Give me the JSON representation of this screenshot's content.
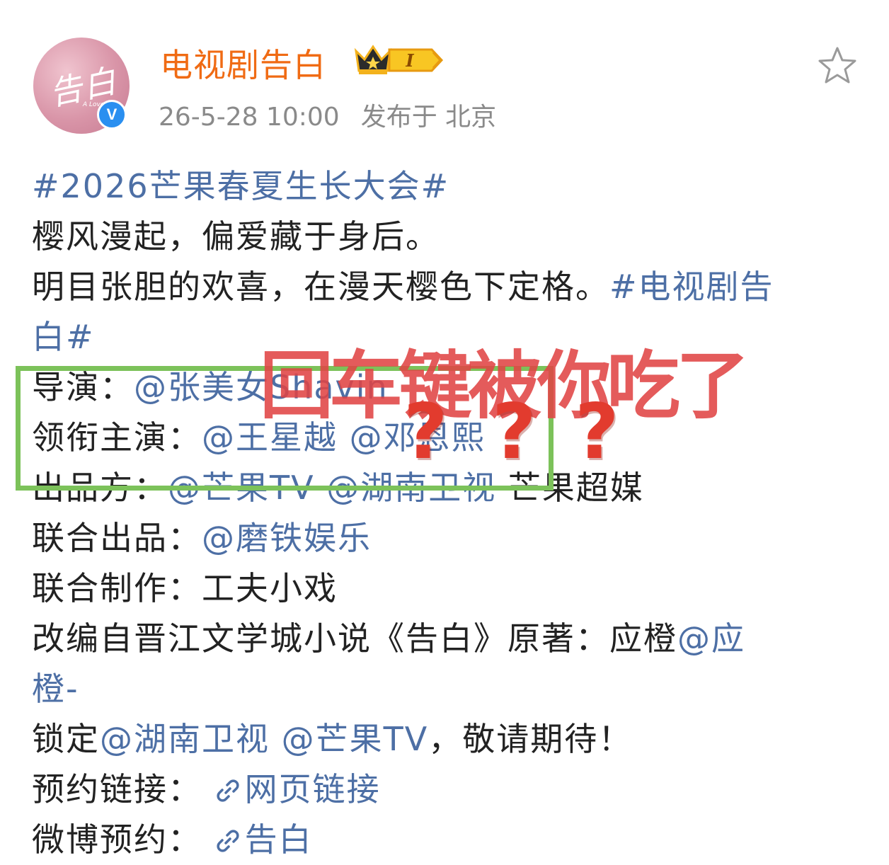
{
  "post": {
    "username": "电视剧告白",
    "avatar_text": "告白",
    "avatar_subtext": "A Love Co",
    "level_badge": "I",
    "verified_mark": "V",
    "timestamp": "26-5-28 10:00",
    "location": "发布于 北京"
  },
  "content": {
    "l1_tag": "#2026芒果春夏生长大会#",
    "l2": "樱风漫起，偏爱藏于身后。",
    "l3_text": "明目张胆的欢喜，在漫天樱色下定格。",
    "l3_tag": "#电视剧告",
    "l4_tag": "白#",
    "l5_label": "导演：",
    "l5_mention": "@张美女Shavin",
    "l6_label": "领衔主演：",
    "l6_mention1": "@王星越",
    "l6_mention2": "@邓恩熙",
    "l7_label": "出品方：",
    "l7_mention1": "@芒果TV",
    "l7_mention2": "@湖南卫视",
    "l7_text": "芒果超媒",
    "l8_label": "联合出品：",
    "l8_mention": "@磨铁娱乐",
    "l9_label": "联合制作：",
    "l9_text": "工夫小戏",
    "l10_text": "改编自晋江文学城小说《告白》原著：应橙",
    "l10_mention": "@应",
    "l11_mention": "橙-",
    "l12_label": "锁定",
    "l12_mention1": "@湖南卫视",
    "l12_mention2": "@芒果TV",
    "l12_text": "，敬请期待！",
    "l13_label": "预约链接：",
    "l13_link": "网页链接",
    "l14_label": "微博预约：",
    "l14_link": "告白"
  },
  "annotation": {
    "overlay_text": "回车键被你吃了",
    "qmark": "?"
  },
  "colors": {
    "username": "#f06b14",
    "link": "#4d6fa5",
    "highlight_box": "#7cc25a",
    "overlay_text": "#e04444"
  },
  "icons": [
    "crown-icon",
    "level-badge-icon",
    "verified-icon",
    "star-icon",
    "link-icon"
  ]
}
